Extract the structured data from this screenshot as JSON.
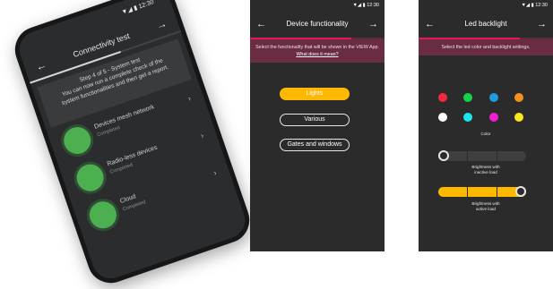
{
  "phone_left": {
    "status": "▼◢ ▮ 12:30",
    "title": "Connectivity test",
    "step_text": [
      "Step 4 of 5 - System test",
      "You can now run a complete check of the",
      "system functionalities and then get a report."
    ],
    "items": [
      {
        "label": "Devices mesh network",
        "status": "Completed"
      },
      {
        "label": "Radio-less devices",
        "status": "Completed"
      },
      {
        "label": "Cloud",
        "status": "Completed"
      }
    ],
    "colors": {
      "check": "#4caf50"
    }
  },
  "screen_middle": {
    "status": "▼◢ ▮ 12:30",
    "title": "Device functionality",
    "instruction": "Select the functionality that will be shown in the VIEW App.",
    "link": "What does it mean?",
    "options": [
      {
        "label": "Lights",
        "selected": true
      },
      {
        "label": "Various",
        "selected": false
      },
      {
        "label": "Gates and windows",
        "selected": false
      }
    ],
    "colors": {
      "accent": "#ffb800",
      "band": "#6a2c42",
      "progress": "#e2185b"
    },
    "progress": 0.75
  },
  "screen_right": {
    "status": "▼◢ ▮ 12:30",
    "title": "Led backlight",
    "instruction": "Select the led color and backlight settings.",
    "colors_label": "Color",
    "led_colors": [
      "#f5283d",
      "#16d24a",
      "#1f9be0",
      "#f7901e",
      "#ffffff",
      "#19e6ef",
      "#f01fd2",
      "#f8e81d"
    ],
    "inactive_label_1": "Brightness with",
    "inactive_label_2": "inactive load",
    "active_label_1": "Brightness with",
    "active_label_2": "active load",
    "inactive_level": 0.0,
    "active_level": 1.0,
    "progress": 0.75
  }
}
